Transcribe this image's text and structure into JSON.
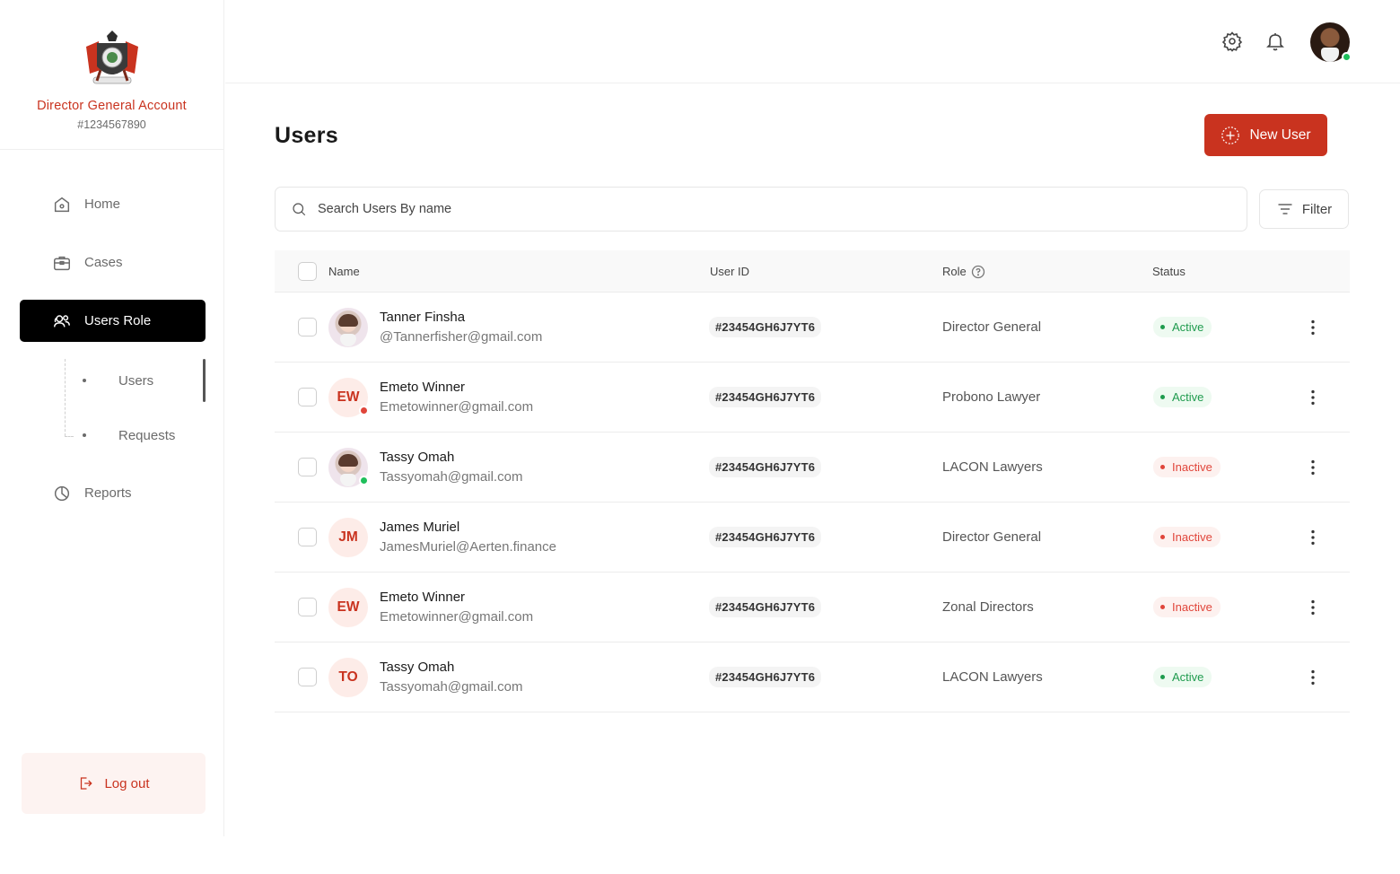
{
  "sidebar": {
    "account_name": "Director General Account",
    "account_id": "#1234567890",
    "nav": [
      {
        "label": "Home",
        "icon": "home-icon"
      },
      {
        "label": "Cases",
        "icon": "briefcase-icon"
      },
      {
        "label": "Users Role",
        "icon": "users-icon"
      },
      {
        "label": "Reports",
        "icon": "pie-chart-icon"
      }
    ],
    "subnav": [
      {
        "label": "Users"
      },
      {
        "label": "Requests"
      }
    ],
    "logout_label": "Log out"
  },
  "header": {
    "icons": [
      "gear-icon",
      "bell-icon"
    ]
  },
  "main": {
    "title": "Users",
    "new_user_label": "New User",
    "search_placeholder": "Search Users By name",
    "filter_label": "Filter",
    "columns": {
      "name": "Name",
      "user_id": "User ID",
      "role": "Role",
      "status": "Status"
    },
    "rows": [
      {
        "name": "Tanner Finsha",
        "email": "@Tannerfisher@gmail.com",
        "initials": "",
        "user_id": "#23454GH6J7YT6",
        "role": "Director General",
        "status": "Active"
      },
      {
        "name": "Emeto  Winner",
        "email": "Emetowinner@gmail.com",
        "initials": "EW",
        "user_id": "#23454GH6J7YT6",
        "role": "Probono Lawyer",
        "status": "Active"
      },
      {
        "name": "Tassy Omah",
        "email": "Tassyomah@gmail.com",
        "initials": "",
        "user_id": "#23454GH6J7YT6",
        "role": "LACON Lawyers",
        "status": "Inactive"
      },
      {
        "name": "James Muriel",
        "email": "JamesMuriel@Aerten.finance",
        "initials": "JM",
        "user_id": "#23454GH6J7YT6",
        "role": "Director General",
        "status": "Inactive"
      },
      {
        "name": "Emeto  Winner",
        "email": "Emetowinner@gmail.com",
        "initials": "EW",
        "user_id": "#23454GH6J7YT6",
        "role": "Zonal Directors",
        "status": "Inactive"
      },
      {
        "name": "Tassy Omah",
        "email": "Tassyomah@gmail.com",
        "initials": "TO",
        "user_id": "#23454GH6J7YT6",
        "role": "LACON Lawyers",
        "status": "Active"
      }
    ]
  },
  "colors": {
    "brand_red": "#c9331f",
    "active_green": "#1f9b4e",
    "inactive_red": "#e0453a",
    "online_green": "#1fbf5b"
  }
}
